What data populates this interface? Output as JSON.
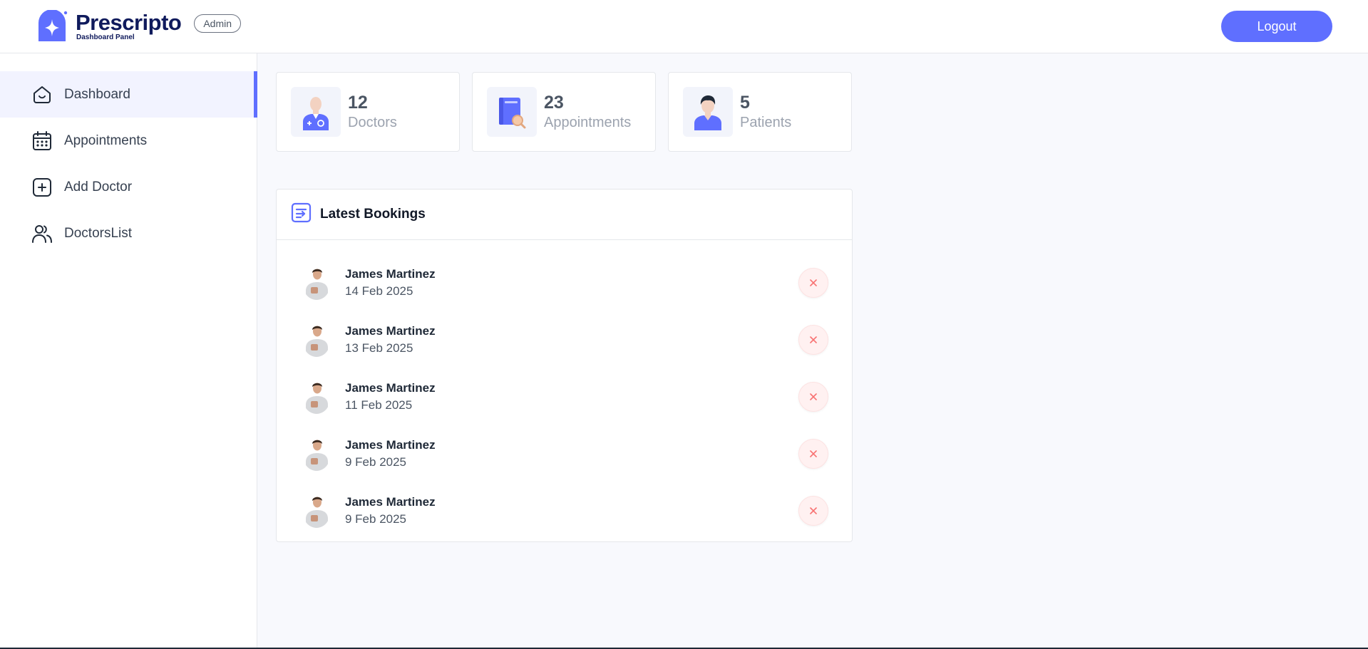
{
  "header": {
    "brand_name": "Prescripto",
    "brand_sub": "Dashboard Panel",
    "badge": "Admin",
    "logout_label": "Logout"
  },
  "sidebar": {
    "items": [
      {
        "label": "Dashboard",
        "icon": "home-icon",
        "active": true
      },
      {
        "label": "Appointments",
        "icon": "calendar-icon",
        "active": false
      },
      {
        "label": "Add Doctor",
        "icon": "add-square-icon",
        "active": false
      },
      {
        "label": "DoctorsList",
        "icon": "people-icon",
        "active": false
      }
    ]
  },
  "stats": [
    {
      "value": "12",
      "label": "Doctors",
      "icon": "doctor-icon"
    },
    {
      "value": "23",
      "label": "Appointments",
      "icon": "appointment-book-icon"
    },
    {
      "value": "5",
      "label": "Patients",
      "icon": "patient-icon"
    }
  ],
  "bookings": {
    "title": "Latest Bookings",
    "rows": [
      {
        "name": "James Martinez",
        "date": "14 Feb 2025"
      },
      {
        "name": "James Martinez",
        "date": "13 Feb 2025"
      },
      {
        "name": "James Martinez",
        "date": "11 Feb 2025"
      },
      {
        "name": "James Martinez",
        "date": "9 Feb 2025"
      },
      {
        "name": "James Martinez",
        "date": "9 Feb 2025"
      }
    ]
  },
  "colors": {
    "accent": "#5f6fff",
    "brand_text": "#0f1a5c",
    "active_bg": "#f2f3ff",
    "cancel_bg": "#fff1f1",
    "cancel_icon": "#f87171"
  }
}
